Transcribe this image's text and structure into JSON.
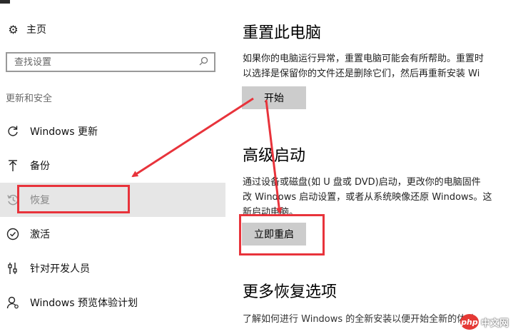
{
  "sidebar": {
    "home_label": "主页",
    "search_placeholder": "查找设置",
    "section_label": "更新和安全",
    "items": [
      {
        "label": "Windows 更新",
        "icon": "refresh-icon"
      },
      {
        "label": "备份",
        "icon": "backup-arrow-icon"
      },
      {
        "label": "恢复",
        "icon": "history-icon",
        "selected": true
      },
      {
        "label": "激活",
        "icon": "check-circle-icon"
      },
      {
        "label": "针对开发人员",
        "icon": "developer-sliders-icon"
      },
      {
        "label": "Windows 预览体验计划",
        "icon": "person-icon"
      }
    ]
  },
  "main": {
    "reset": {
      "title": "重置此电脑",
      "desc_line1": "如果你的电脑运行异常，重置电脑可能会有所帮助。重置时",
      "desc_line2": "以选择是保留你的文件还是删除它们，然后再重新安装 Wi",
      "button": "开始"
    },
    "advanced": {
      "title": "高级启动",
      "desc_line1": "通过设备或磁盘(如 U 盘或 DVD)启动，更改你的电脑固件",
      "desc_line2": "改 Windows 启动设置，或者从系统映像还原 Windows。这",
      "desc_line3": "新启动电脑。",
      "button": "立即重启"
    },
    "more": {
      "title": "更多恢复选项",
      "link": "了解如何进行 Windows 的全新安装以便开始全新的体验"
    }
  },
  "watermark": {
    "logo": "php",
    "text": "中文网"
  },
  "colors": {
    "annotation": "#e8333b",
    "button": "#cccccc",
    "selected": "#e6e6e6"
  }
}
